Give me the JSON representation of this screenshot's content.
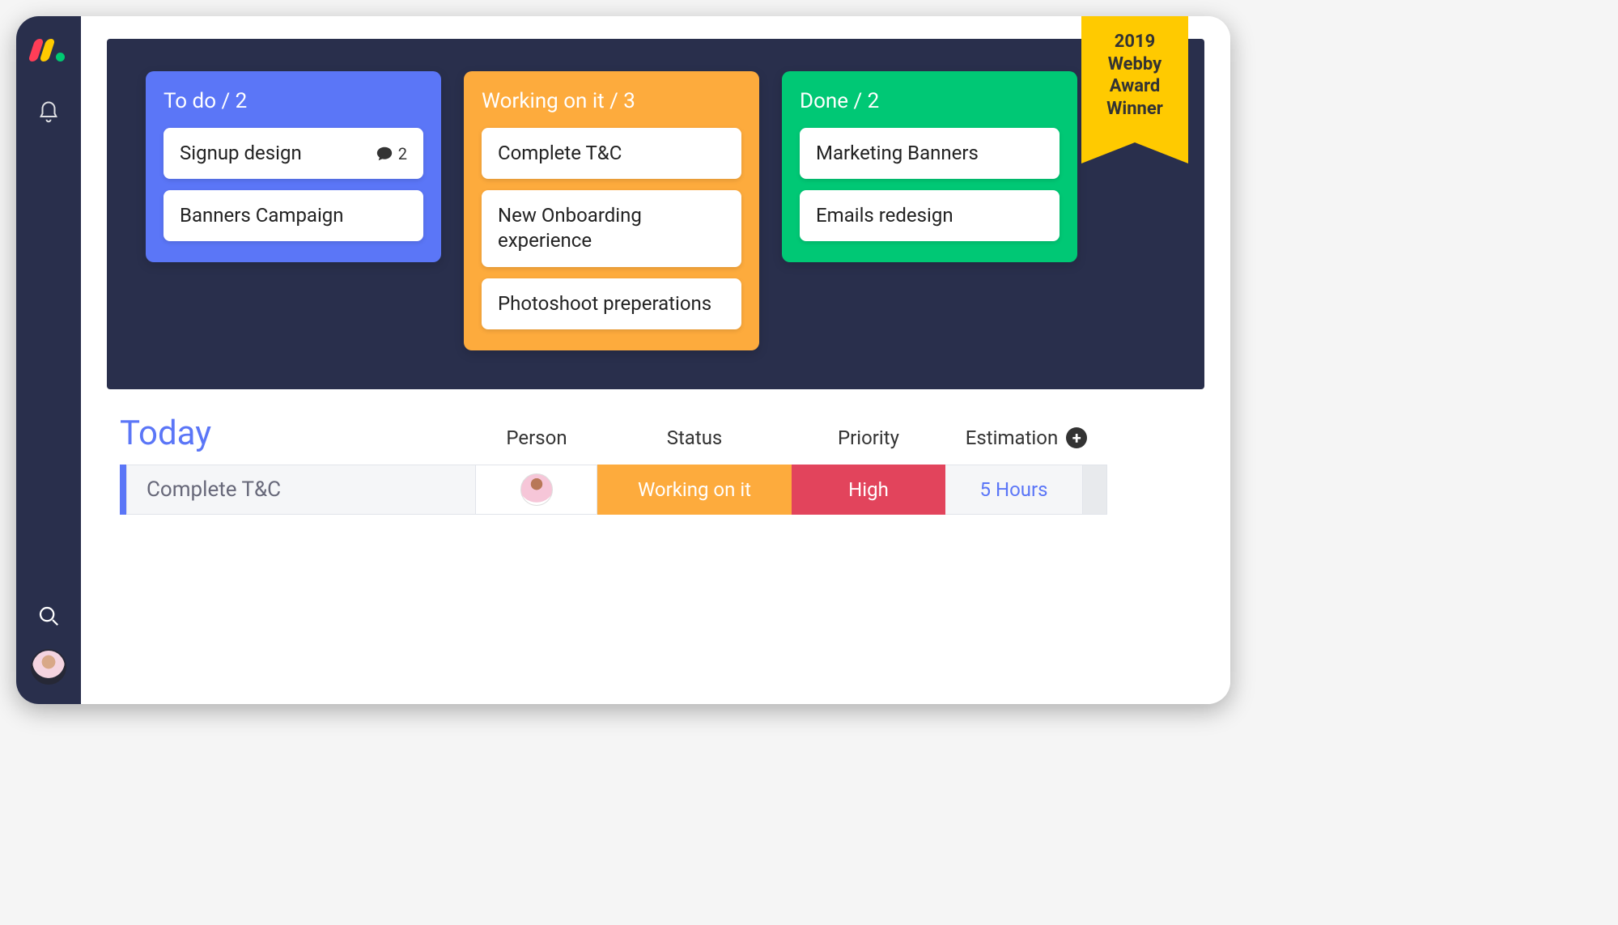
{
  "ribbon": {
    "line1": "2019",
    "line2": "Webby",
    "line3": "Award",
    "line4": "Winner"
  },
  "board": {
    "columns": [
      {
        "id": "todo",
        "title": "To do / 2",
        "color": "#5B76F7",
        "cards": [
          {
            "title": "Signup design",
            "comments": "2"
          },
          {
            "title": "Banners Campaign"
          }
        ]
      },
      {
        "id": "working",
        "title": "Working on it / 3",
        "color": "#FDAB3D",
        "cards": [
          {
            "title": "Complete T&C"
          },
          {
            "title": "New Onboarding experience"
          },
          {
            "title": "Photoshoot preperations"
          }
        ]
      },
      {
        "id": "done",
        "title": "Done / 2",
        "color": "#00C875",
        "cards": [
          {
            "title": "Marketing Banners"
          },
          {
            "title": "Emails redesign"
          }
        ]
      }
    ]
  },
  "today": {
    "title": "Today",
    "headers": {
      "person": "Person",
      "status": "Status",
      "priority": "Priority",
      "estimation": "Estimation"
    },
    "row": {
      "task": "Complete T&C",
      "status": "Working on it",
      "priority": "High",
      "estimation": "5 Hours"
    }
  }
}
